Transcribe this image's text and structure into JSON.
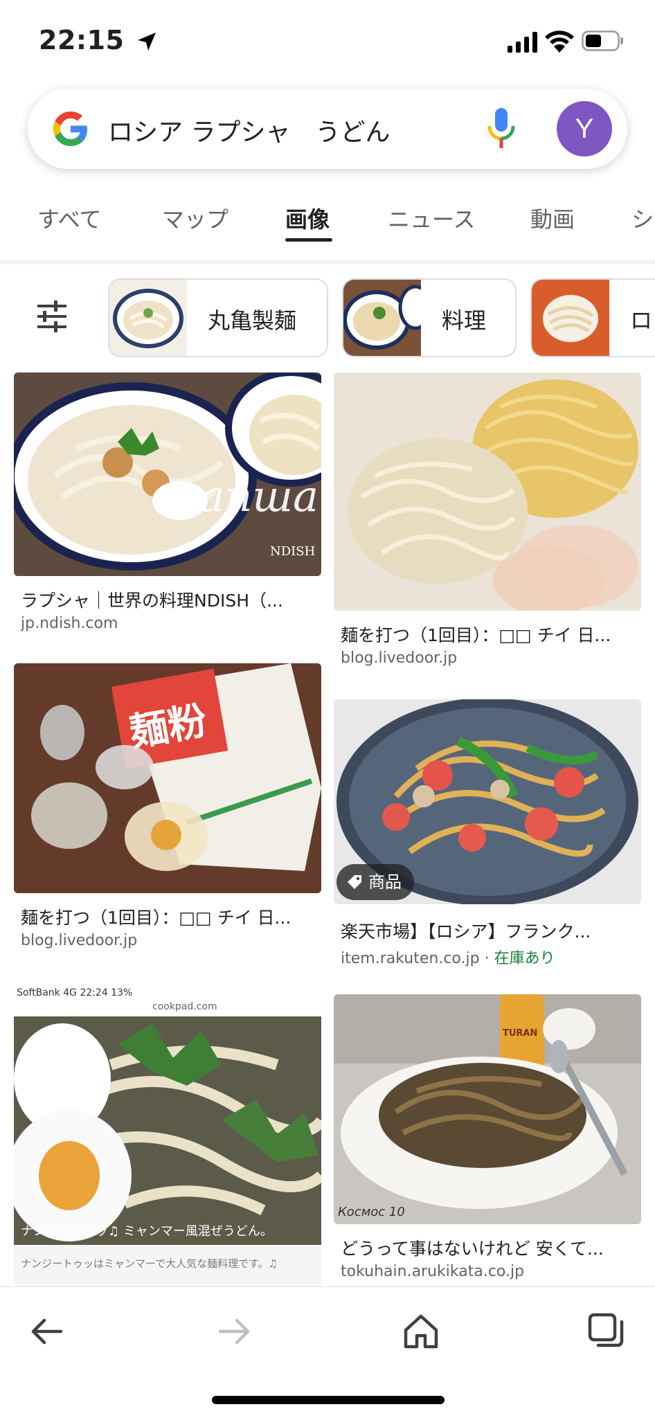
{
  "status_bar": {
    "time": "22:15"
  },
  "search": {
    "query": "ロシア ラプシャ　うどん",
    "avatar_letter": "Y"
  },
  "tabs": [
    {
      "label": "すべて",
      "active": false
    },
    {
      "label": "マップ",
      "active": false
    },
    {
      "label": "画像",
      "active": true
    },
    {
      "label": "ニュース",
      "active": false
    },
    {
      "label": "動画",
      "active": false
    },
    {
      "label": "シ",
      "active": false
    }
  ],
  "chips": [
    {
      "label": "丸亀製麺"
    },
    {
      "label": "料理"
    },
    {
      "label": "ロ"
    }
  ],
  "results": [
    {
      "title": "ラプシャ｜世界の料理NDISH（...",
      "source": "jp.ndish.com",
      "image_text": "лапша",
      "image_logo": "NDISH"
    },
    {
      "title": "麺を打つ（1回目）：□□ チイ 日...",
      "source": "blog.livedoor.jp"
    },
    {
      "title": "麺を打つ（1回目）：□□ チイ 日...",
      "source": "blog.livedoor.jp",
      "image_text": "麺粉"
    },
    {
      "title": "楽天市場】【ロシア】フランク...",
      "source": "item.rakuten.co.jp",
      "separator": " · ",
      "stock": "在庫あり",
      "badge": "商品"
    },
    {
      "image_caption": "ナンジートゥッ♫ ミャンマー風混ぜうどん。",
      "image_subcaption": "ナンジートゥッはミャンマーで大人気な麺料理です。♫",
      "image_status": "SoftBank 4G   22:24   13%",
      "image_url": "cookpad.com"
    },
    {
      "title": "どうって事はないけれど 安くて...",
      "source": "tokuhain.arukikata.co.jp",
      "image_text": "Космос 10",
      "image_label": "TURAN"
    }
  ],
  "colors": {
    "accent": "#1a73e8",
    "avatar": "#7e57c2",
    "stock_green": "#188038"
  }
}
